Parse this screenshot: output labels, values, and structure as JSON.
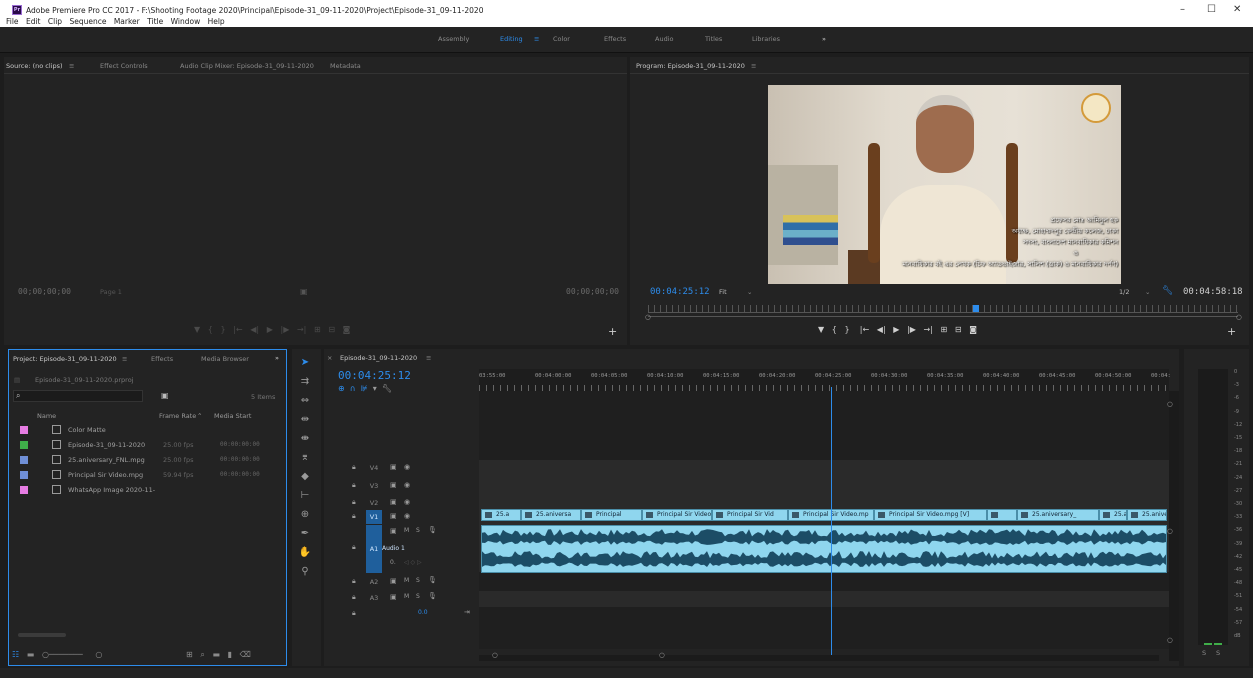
{
  "window": {
    "title": "Adobe Premiere Pro CC 2017 - F:\\Shooting Footage 2020\\Principal\\Episode-31_09-11-2020\\Project\\Episode-31_09-11-2020",
    "logo_text": "Pr",
    "minimize": "–",
    "maximize": "☐",
    "close": "✕"
  },
  "menubar": [
    "File",
    "Edit",
    "Clip",
    "Sequence",
    "Marker",
    "Title",
    "Window",
    "Help"
  ],
  "workspaces": {
    "items": [
      "Assembly",
      "Editing",
      "Color",
      "Effects",
      "Audio",
      "Titles",
      "Libraries"
    ],
    "active": "Editing",
    "menu_glyph": "≡",
    "more": "»"
  },
  "source_panel": {
    "tabs": [
      "Source: (no clips)",
      "Effect Controls",
      "Audio Clip Mixer: Episode-31_09-11-2020",
      "Metadata"
    ],
    "tab_menu": "≡",
    "timecode_left": "00;00;00;00",
    "timecode_right": "00;00;00;00",
    "page": "Page 1"
  },
  "program_panel": {
    "title": "Program: Episode-31_09-11-2020",
    "tab_menu": "≡",
    "timecode": "00:04:25:12",
    "fit": "Fit",
    "resolution": "1/2",
    "duration": "00:04:58:18",
    "subtitle_lines": [
      "প্রফেসর মোঃ আমিনুল হক",
      "অধ্যক্ষ, মোহাম্মদপুর কেন্দ্রীয় কলেজ, ঢাকা",
      "সদস্য, বাংলাদেশ মানবাধিকার কমিশন",
      "ও",
      "মানবাধিকার বই এর লেখক (চিফ অ্যাডভাইজার, সালিশ (ডাক) ও মানবাধিকার দর্পণ)"
    ],
    "playhead_fraction": 0.55
  },
  "project_panel": {
    "tabs": [
      "Project: Episode-31_09-11-2020",
      "Effects",
      "Media Browser"
    ],
    "tab_menu": "≡",
    "more": "»",
    "project_file": "Episode-31_09-11-2020.prproj",
    "item_count": "5 Items",
    "columns": [
      "Name",
      "Frame Rate",
      "Media Start"
    ],
    "sort_glyph": "⌃",
    "items": [
      {
        "name": "Color Matte",
        "frame_rate": "",
        "media_start": "",
        "color": "#e67de3"
      },
      {
        "name": "Episode-31_09-11-2020",
        "frame_rate": "25.00 fps",
        "media_start": "00:00:00:00",
        "color": "#3fae49"
      },
      {
        "name": "25.aniversary_FNL.mpg",
        "frame_rate": "25.00 fps",
        "media_start": "00:00:00:00",
        "color": "#6f8fd6"
      },
      {
        "name": "Principal Sir Video.mpg",
        "frame_rate": "59.94 fps",
        "media_start": "00:00:00:00",
        "color": "#6f8fd6"
      },
      {
        "name": "WhatsApp Image 2020-11-",
        "frame_rate": "",
        "media_start": "",
        "color": "#e67de3"
      }
    ]
  },
  "timeline": {
    "sequence_tab": "Episode-31_09-11-2020",
    "close_glyph": "×",
    "tab_menu": "≡",
    "timecode": "00:04:25:12",
    "ruler": [
      "03:55:00",
      "00:04:00:00",
      "00:04:05:00",
      "00:04:10:00",
      "00:04:15:00",
      "00:04:20:00",
      "00:04:25:00",
      "00:04:30:00",
      "00:04:35:00",
      "00:04:40:00",
      "00:04:45:00",
      "00:04:50:00",
      "00:04:"
    ],
    "tracks": [
      {
        "name": "V4"
      },
      {
        "name": "V3"
      },
      {
        "name": "V2"
      },
      {
        "name": "V1"
      },
      {
        "name": "A1",
        "label": "Audio 1",
        "volume": "0."
      },
      {
        "name": "A2"
      },
      {
        "name": "A3"
      }
    ],
    "master_value": "0.0",
    "track_buttons": {
      "mute": "M",
      "solo": "S"
    },
    "v1_clips": [
      "25.a",
      "25.aniversa",
      "Principal",
      "Principal Sir Video.",
      "Principal Sir Vid",
      "Principal Sir Video.mp",
      "Principal Sir Video.mpg [V]",
      "",
      "25.aniversary_",
      "25.an",
      "25.anive"
    ],
    "playhead_fraction": 0.51
  },
  "audio_meter": {
    "ticks": [
      "0",
      "-3",
      "-6",
      "-9",
      "-12",
      "-15",
      "-18",
      "-21",
      "-24",
      "-27",
      "-30",
      "-33",
      "-36",
      "-39",
      "-42",
      "-45",
      "-48",
      "-51",
      "-54",
      "-57",
      "dB"
    ],
    "solo_left": "S",
    "solo_right": "S"
  },
  "colors": {
    "accent": "#2d8ceb",
    "clip_video": "#8fd6ee",
    "clip_audio": "#8fd6ee",
    "track_active": "#1f5f9c"
  }
}
